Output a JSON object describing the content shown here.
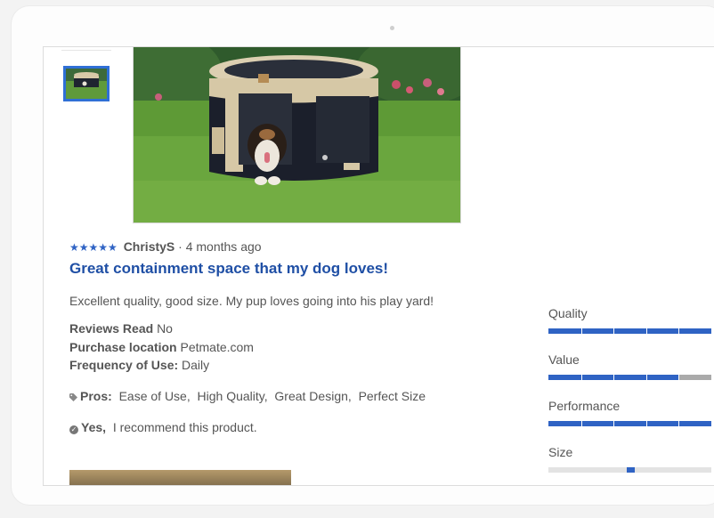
{
  "review": {
    "stars": "★★★★★",
    "rating": 5,
    "author": "ChristyS",
    "separator": " · ",
    "time_ago": "4 months ago",
    "headline": "Great containment space that my dog loves!",
    "body": "Excellent quality, good size. My pup loves going into his play yard!",
    "details": [
      {
        "label": "Reviews Read",
        "value": "No"
      },
      {
        "label": "Purchase location",
        "value": "Petmate.com"
      },
      {
        "label": "Frequency of Use:",
        "value": "Daily"
      }
    ],
    "pros_label": "Pros:",
    "pros": [
      "Ease of Use,",
      "High Quality,",
      "Great Design,",
      "Perfect Size"
    ],
    "recommend_label": "Yes,",
    "recommend_text": "I recommend this product."
  },
  "ratings": [
    {
      "label": "Quality",
      "fraction": 1.0
    },
    {
      "label": "Value",
      "fraction": 0.8
    },
    {
      "label": "Performance",
      "fraction": 1.0
    },
    {
      "label": "Size",
      "fraction": 0.5
    }
  ],
  "colors": {
    "accent": "#2f63c4",
    "headline": "#1f4fa5",
    "thumb_border": "#2f6fd6",
    "bar_empty": "#aaaaaa"
  },
  "icons": {
    "tag": "tag-icon",
    "check": "check-circle-icon"
  }
}
